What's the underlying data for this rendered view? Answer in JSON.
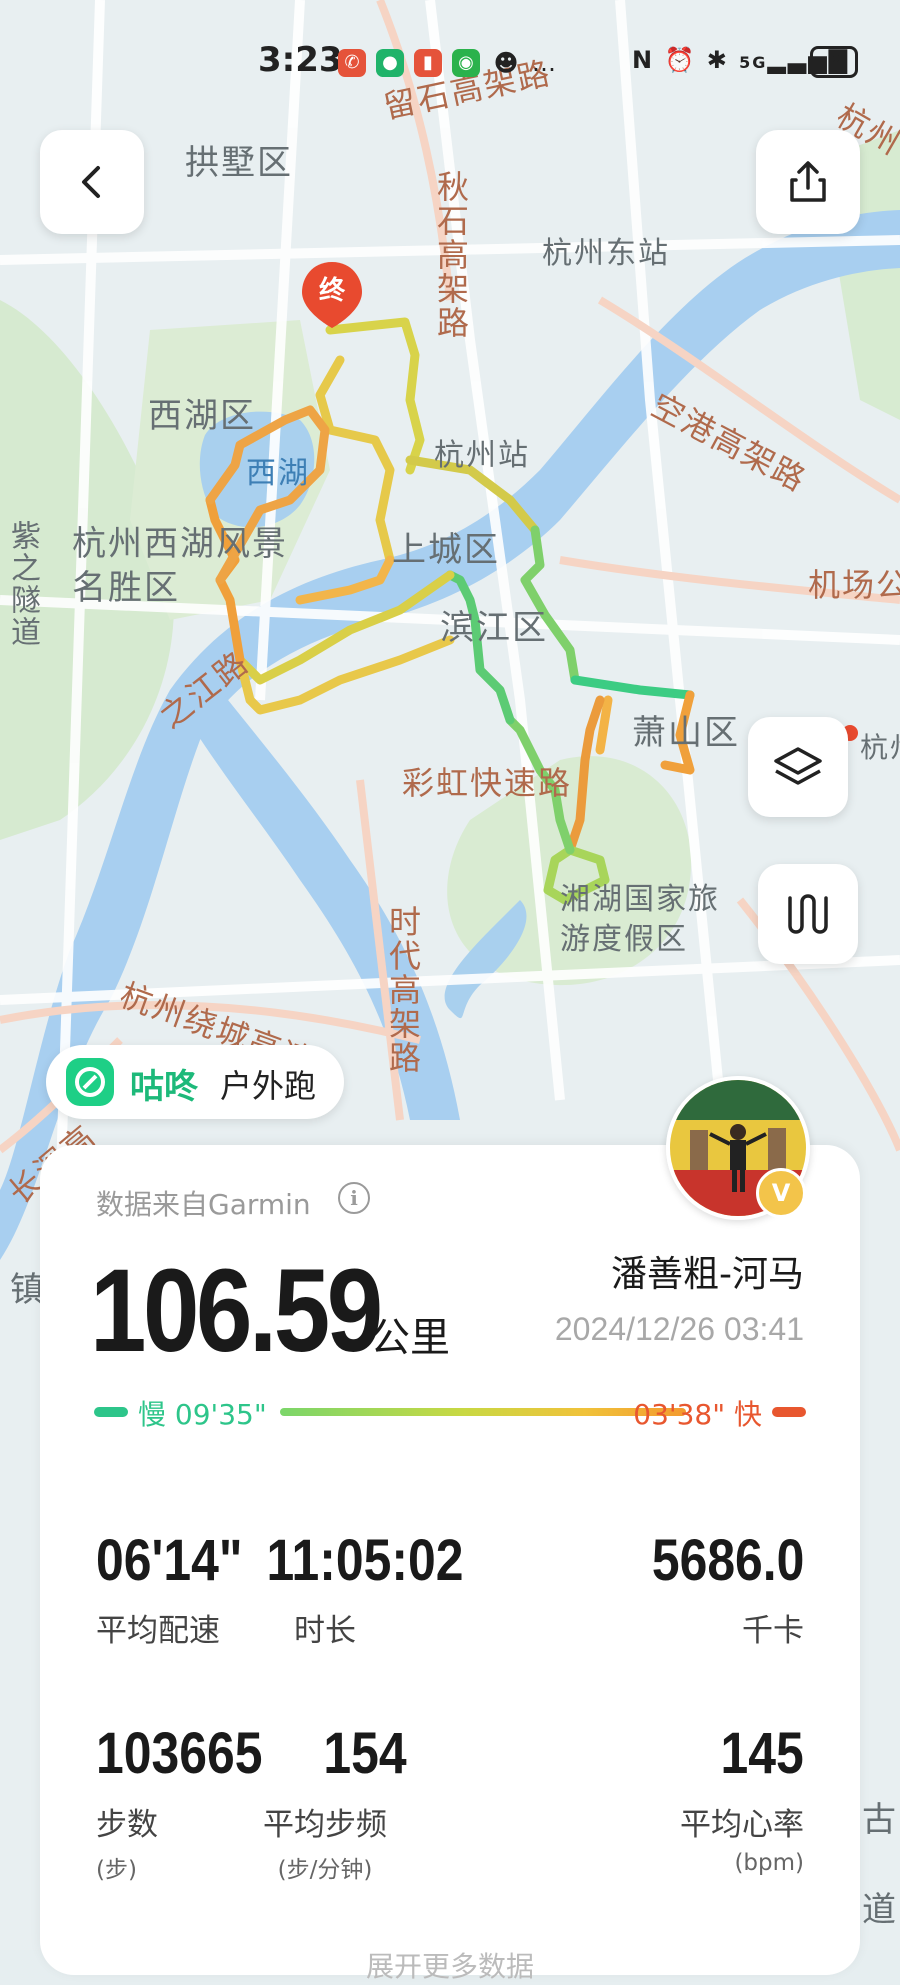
{
  "status_bar": {
    "time": "3:23",
    "battery": "2",
    "network": "5G"
  },
  "map_labels": {
    "gongshu": "拱墅区",
    "liushi": "留石高架路",
    "qiushi": "秋石高架路",
    "hz_east": "杭州东站",
    "xihu_district": "西湖区",
    "xihu_lake": "西湖",
    "hz_station": "杭州站",
    "konggang": "空港高架路",
    "scenic": "杭州西湖风景名胜区",
    "zizhi": "紫之隧道",
    "shangcheng": "上城区",
    "jichang": "机场公",
    "binjiang": "滨江区",
    "zhijiang": "之江路",
    "xiaoshan": "萧山区",
    "hangzhou_edge": "杭州",
    "caihong": "彩虹快速路",
    "xianghu": "湘湖国家旅游度假区",
    "shidai": "时代高架路",
    "raocheng": "杭州绕城高速",
    "changshen": "长深高",
    "zhen": "镇",
    "gu": "古",
    "dao": "道",
    "hang_top": "杭州",
    "end_marker": "终"
  },
  "header": {
    "back_icon": "back-arrow-icon",
    "share_icon": "share-icon"
  },
  "map_controls": {
    "layers_icon": "layers-icon",
    "route_icon": "route-icon"
  },
  "brand": {
    "name": "咕咚",
    "activity": "户外跑"
  },
  "summary": {
    "source": "数据来自Garmin",
    "info_symbol": "i",
    "distance": "106.59",
    "distance_unit": "公里",
    "user_name": "潘善粗-河马",
    "datetime": "2024/12/26 03:41",
    "badge": "V",
    "pace_legend": {
      "slow": "慢 09'35\"",
      "fast": "03'38\" 快",
      "slow_color": "#2dc58a",
      "fast_color": "#e8572f"
    }
  },
  "stats": [
    {
      "value": "06'14\"",
      "label": "平均配速",
      "unit": ""
    },
    {
      "value": "11:05:02",
      "label": "时长",
      "unit": ""
    },
    {
      "value": "5686.0",
      "label": "千卡",
      "unit": ""
    },
    {
      "value": "103665",
      "label": "步数",
      "unit": "(步)"
    },
    {
      "value": "154",
      "label": "平均步频",
      "unit": "(步/分钟)"
    },
    {
      "value": "145",
      "label": "平均心率",
      "unit": "(bpm)"
    }
  ],
  "more_text": "展开更多数据"
}
